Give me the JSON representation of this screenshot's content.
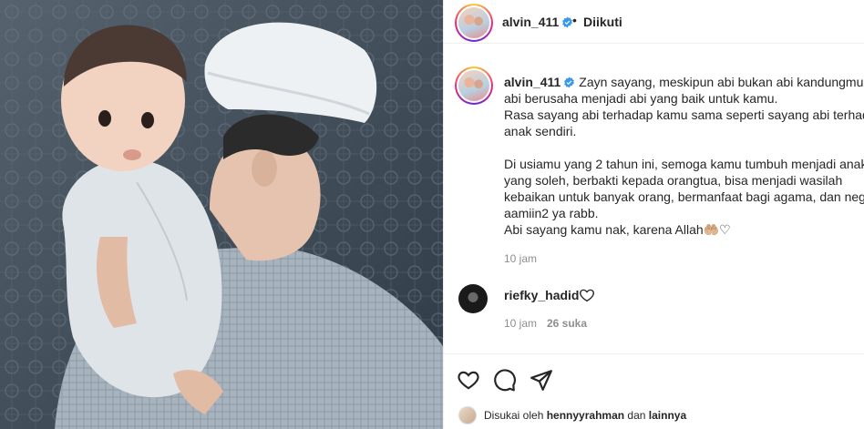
{
  "post": {
    "author": "alvin_411",
    "separator": "•",
    "follow_state": "Diikuti"
  },
  "caption": {
    "author": "alvin_411",
    "lines": [
      "Zayn sayang, meskipun abi bukan abi kandungmu, t",
      "abi berusaha menjadi abi yang baik untuk kamu.",
      "Rasa sayang abi terhadap kamu sama seperti sayang abi terhada",
      "anak sendiri.",
      "",
      "Di usiamu yang 2 tahun ini, semoga kamu tumbuh menjadi anak",
      "yang soleh, berbakti kepada orangtua, bisa menjadi wasilah",
      "kebaikan untuk banyak orang, bermanfaat bagi agama, dan nega",
      "aamiin2 ya rabb.",
      "Abi sayang kamu nak, karena Allah🤲🏼♡"
    ],
    "time": "10 jam"
  },
  "comment": {
    "author": "riefky_hadid",
    "time": "10 jam",
    "likes": "26 suka"
  },
  "likes": {
    "prefix": "Disukai oleh",
    "user": "hennyyrahman",
    "connector": "dan",
    "others": "lainnya"
  },
  "icons": {
    "verified": "verified-badge-icon",
    "like": "heart-icon",
    "comment": "comment-icon",
    "share": "send-icon"
  },
  "colors": {
    "verified": "#3897f0",
    "text": "#262626",
    "muted": "#8e8e8e"
  }
}
